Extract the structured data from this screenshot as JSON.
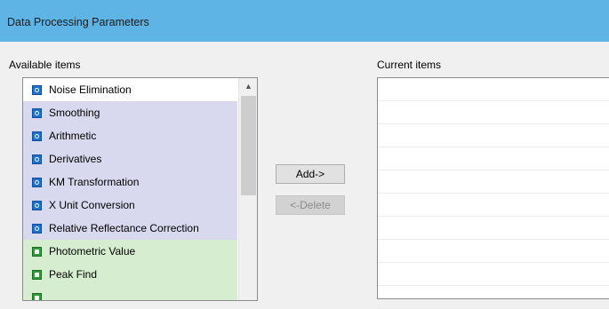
{
  "window": {
    "title": "Data Processing Parameters"
  },
  "available": {
    "label": "Available items",
    "items": [
      {
        "label": "Noise Elimination",
        "icon": "blue-module-icon",
        "group": "first"
      },
      {
        "label": "Smoothing",
        "icon": "blue-module-icon",
        "group": "blue"
      },
      {
        "label": "Arithmetic",
        "icon": "blue-module-icon",
        "group": "blue"
      },
      {
        "label": "Derivatives",
        "icon": "blue-module-icon",
        "group": "blue"
      },
      {
        "label": "KM Transformation",
        "icon": "blue-module-icon",
        "group": "blue"
      },
      {
        "label": "X Unit Conversion",
        "icon": "blue-module-icon",
        "group": "blue"
      },
      {
        "label": "Relative Reflectance Correction",
        "icon": "blue-module-icon",
        "group": "blue"
      },
      {
        "label": "Photometric Value",
        "icon": "green-report-icon",
        "group": "green"
      },
      {
        "label": "Peak Find",
        "icon": "green-report-icon",
        "group": "green"
      },
      {
        "label": "",
        "icon": "green-report-icon",
        "group": "green"
      }
    ]
  },
  "buttons": {
    "add": "Add->",
    "delete": "<-Delete"
  },
  "current": {
    "label": "Current items",
    "rows": 10
  },
  "colors": {
    "titlebar": "#5fb4e6",
    "blue_group": "#d8d8ef",
    "green_group": "#d6eecf"
  }
}
